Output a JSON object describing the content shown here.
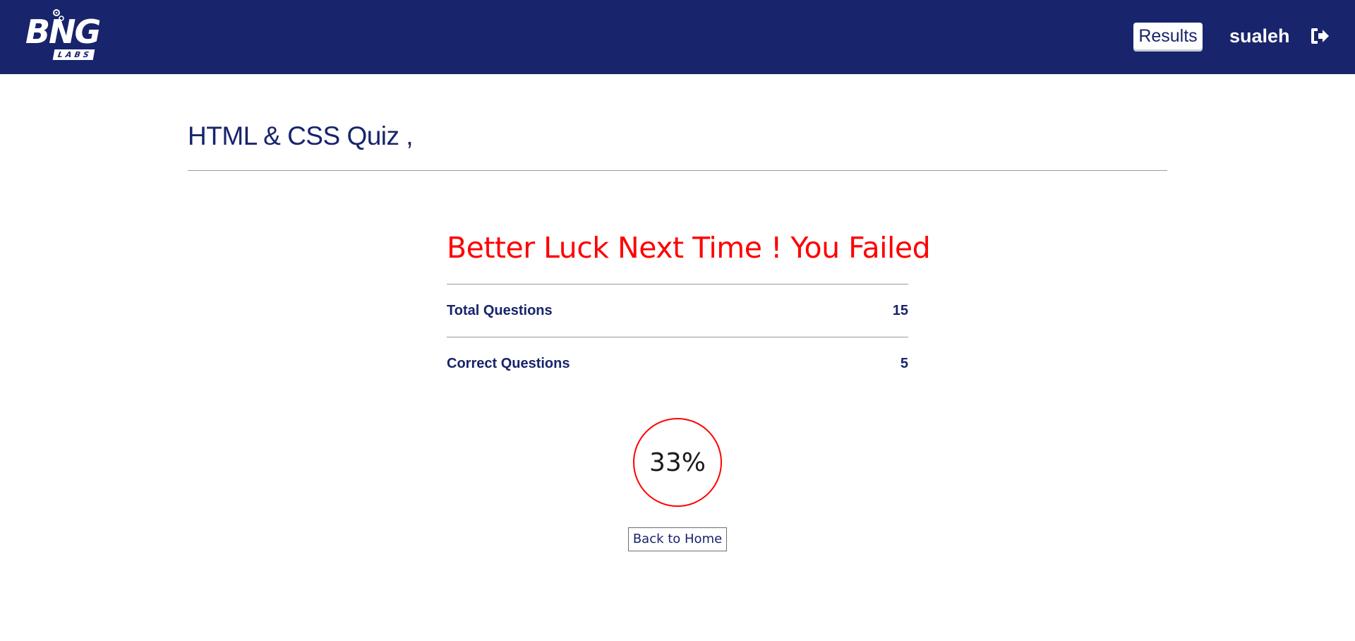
{
  "header": {
    "logo": {
      "text": "BNG",
      "subtext": "LABS"
    },
    "nav": {
      "results_label": "Results",
      "username": "sualeh",
      "logout_icon": "sign-out-icon"
    },
    "colors": {
      "navbar": "#18246b",
      "accent_text": "#18246b"
    }
  },
  "main": {
    "quiz_title": "HTML & CSS Quiz ,",
    "result_message": "Better Luck Next Time ! You Failed",
    "stats": [
      {
        "label": "Total Questions",
        "value": "15"
      },
      {
        "label": "Correct Questions",
        "value": "5"
      }
    ],
    "score_percent": "33%",
    "back_button_label": "Back to Home",
    "colors": {
      "fail": "#ff0000"
    }
  }
}
